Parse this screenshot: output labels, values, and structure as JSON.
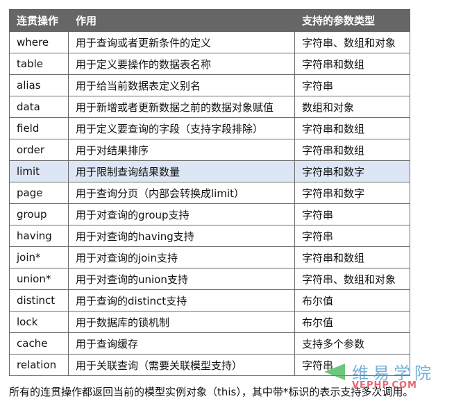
{
  "table": {
    "headers": [
      "连贯操作",
      "作用",
      "支持的参数类型"
    ],
    "highlight_row": 6,
    "rows": [
      {
        "op": "where",
        "desc": "用于查询或者更新条件的定义",
        "type": "字符串、数组和对象"
      },
      {
        "op": "table",
        "desc": "用于定义要操作的数据表名称",
        "type": "字符串和数组"
      },
      {
        "op": "alias",
        "desc": "用于给当前数据表定义别名",
        "type": "字符串"
      },
      {
        "op": "data",
        "desc": "用于新增或者更新数据之前的数据对象赋值",
        "type": "数组和对象"
      },
      {
        "op": "field",
        "desc": "用于定义要查询的字段（支持字段排除）",
        "type": "字符串和数组"
      },
      {
        "op": "order",
        "desc": "用于对结果排序",
        "type": "字符串和数组"
      },
      {
        "op": "limit",
        "desc": "用于限制查询结果数量",
        "type": "字符串和数字"
      },
      {
        "op": "page",
        "desc": "用于查询分页（内部会转换成limit）",
        "type": "字符串和数字"
      },
      {
        "op": "group",
        "desc": "用于对查询的group支持",
        "type": "字符串"
      },
      {
        "op": "having",
        "desc": "用于对查询的having支持",
        "type": "字符串"
      },
      {
        "op": "join*",
        "desc": "用于对查询的join支持",
        "type": "字符串和数组"
      },
      {
        "op": "union*",
        "desc": "用于对查询的union支持",
        "type": "字符串、数组和对象"
      },
      {
        "op": "distinct",
        "desc": "用于查询的distinct支持",
        "type": "布尔值"
      },
      {
        "op": "lock",
        "desc": "用于数据库的锁机制",
        "type": "布尔值"
      },
      {
        "op": "cache",
        "desc": "用于查询缓存",
        "type": "支持多个参数"
      },
      {
        "op": "relation",
        "desc": "用于关联查询（需要关联模型支持）",
        "type": "字符串"
      }
    ]
  },
  "footer": "所有的连贯操作都返回当前的模型实例对象（this），其中带*标识的表示支持多次调用。",
  "watermark": {
    "cn": "维易学院",
    "en": "VEPHP.COM"
  },
  "colors": {
    "header_bg": "#666666",
    "highlight_bg": "#dce6f4",
    "border": "#6b6b6b"
  }
}
